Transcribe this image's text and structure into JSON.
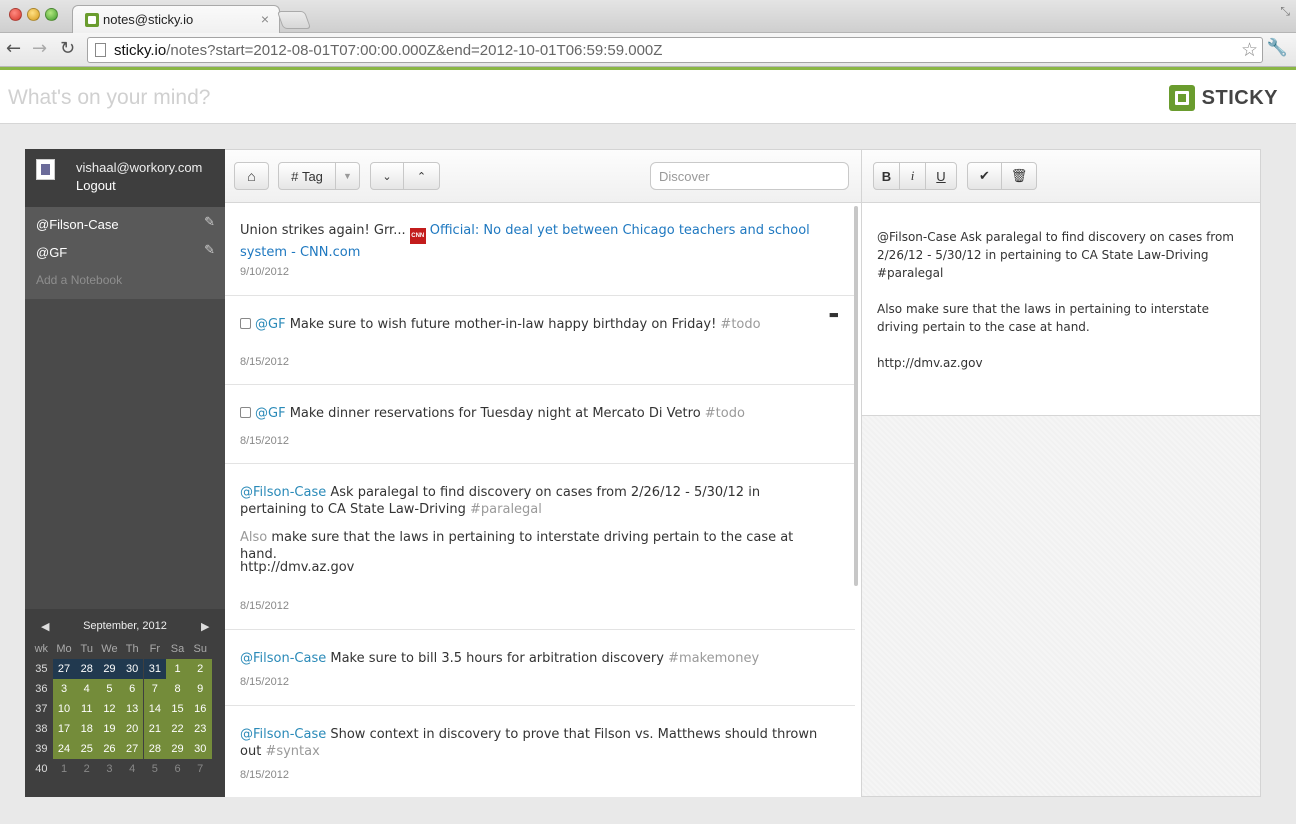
{
  "browser": {
    "tab_title": "notes@sticky.io",
    "tab_close": "×",
    "url_host": "sticky.io",
    "url_path": "/notes?start=2012-08-01T07:00:00.000Z&end=2012-10-01T06:59:59.000Z"
  },
  "header": {
    "compose_placeholder": "What's on your mind?",
    "logo_text": "STICKY"
  },
  "user": {
    "email": "vishaal@workory.com",
    "logout_label": "Logout"
  },
  "notebooks": {
    "items": [
      {
        "label": "@Filson-Case"
      },
      {
        "label": "@GF"
      }
    ],
    "add_label": "Add a Notebook"
  },
  "calendar": {
    "title": "September, 2012",
    "headers": [
      "wk",
      "Mo",
      "Tu",
      "We",
      "Th",
      "Fr",
      "Sa",
      "Su"
    ],
    "weeks": [
      {
        "wk": "35",
        "days": [
          "27",
          "28",
          "29",
          "30",
          "31",
          "1",
          "2"
        ]
      },
      {
        "wk": "36",
        "days": [
          "3",
          "4",
          "5",
          "6",
          "7",
          "8",
          "9"
        ]
      },
      {
        "wk": "37",
        "days": [
          "10",
          "11",
          "12",
          "13",
          "14",
          "15",
          "16"
        ]
      },
      {
        "wk": "38",
        "days": [
          "17",
          "18",
          "19",
          "20",
          "21",
          "22",
          "23"
        ]
      },
      {
        "wk": "39",
        "days": [
          "24",
          "25",
          "26",
          "27",
          "28",
          "29",
          "30"
        ]
      },
      {
        "wk": "40",
        "days": [
          "1",
          "2",
          "3",
          "4",
          "5",
          "6",
          "7"
        ]
      }
    ],
    "colors": {
      "prev_month": "#21394f",
      "current_month": "#748c3a"
    }
  },
  "list_toolbar": {
    "tag_label": "Tag",
    "discover_placeholder": "Discover"
  },
  "notes": [
    {
      "text": "Union strikes again! Grr... ",
      "cnn_icon": "CNN",
      "link": "Official: No deal yet between Chicago teachers and school system - CNN.com",
      "date": "9/10/2012"
    },
    {
      "mention": "@GF",
      "text": " Make sure to wish future mother-in-law happy birthday on Friday! ",
      "tag": "#todo",
      "date": "8/15/2012"
    },
    {
      "mention": "@GF",
      "text": " Make dinner reservations for Tuesday night at Mercato Di Vetro ",
      "tag": "#todo",
      "date": "8/15/2012"
    },
    {
      "mention": "@Filson-Case",
      "text": " Ask paralegal to find discovery on cases from 2/26/12 - 5/30/12 in pertaining to CA State Law-Driving ",
      "tag": "#paralegal",
      "line2_dim": "Also",
      "line2": " make sure that the laws in pertaining to interstate driving pertain to the case at hand.",
      "line3": "http://dmv.az.gov",
      "date": "8/15/2012"
    },
    {
      "mention": "@Filson-Case",
      "text": " Make sure to bill 3.5 hours for arbitration discovery ",
      "tag": "#makemoney",
      "date": "8/15/2012"
    },
    {
      "mention": "@Filson-Case",
      "text": " Show context in discovery to prove that Filson vs. Matthews should thrown out ",
      "tag": "#syntax",
      "date": "8/15/2012"
    }
  ],
  "detail": {
    "format_bold": "B",
    "format_italic": "i",
    "format_underline": "U",
    "line1": "@Filson-Case Ask paralegal to find discovery on cases from 2/26/12 - 5/30/12 in pertaining to CA State Law-Driving #paralegal",
    "line2": "Also make sure that the laws in pertaining to interstate driving pertain to the case at hand.",
    "line3": "http://dmv.az.gov"
  },
  "colors": {
    "accent": "#8ab645",
    "sidebar": "#4a4a4a",
    "mention": "#2a8ab8",
    "link": "#1e78c0"
  }
}
